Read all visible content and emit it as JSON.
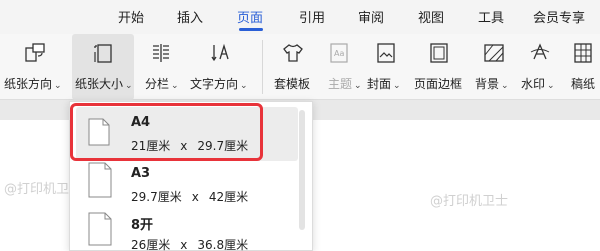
{
  "tabs": [
    {
      "label": "开始",
      "active": false
    },
    {
      "label": "插入",
      "active": false
    },
    {
      "label": "页面",
      "active": true
    },
    {
      "label": "引用",
      "active": false
    },
    {
      "label": "审阅",
      "active": false
    },
    {
      "label": "视图",
      "active": false
    },
    {
      "label": "工具",
      "active": false
    },
    {
      "label": "会员专享",
      "active": false
    }
  ],
  "ribbon": {
    "orientation": "纸张方向",
    "paper_size": "纸张大小",
    "columns": "分栏",
    "text_direction": "文字方向",
    "template": "套模板",
    "theme": "主题",
    "cover": "封面",
    "page_border": "页面边框",
    "background": "背景",
    "watermark": "水印",
    "manuscript": "稿纸"
  },
  "paper_sizes": [
    {
      "name": "A4",
      "width": "21厘米",
      "height": "29.7厘米",
      "selected": true
    },
    {
      "name": "A3",
      "width": "29.7厘米",
      "height": "42厘米",
      "selected": false
    },
    {
      "name": "8开",
      "width": "26厘米",
      "height": "36.8厘米",
      "selected": false
    }
  ],
  "separator": "x",
  "watermark_text": "@打印机卫士",
  "colors": {
    "accent": "#2a5fd6",
    "highlight": "#e8333a"
  }
}
